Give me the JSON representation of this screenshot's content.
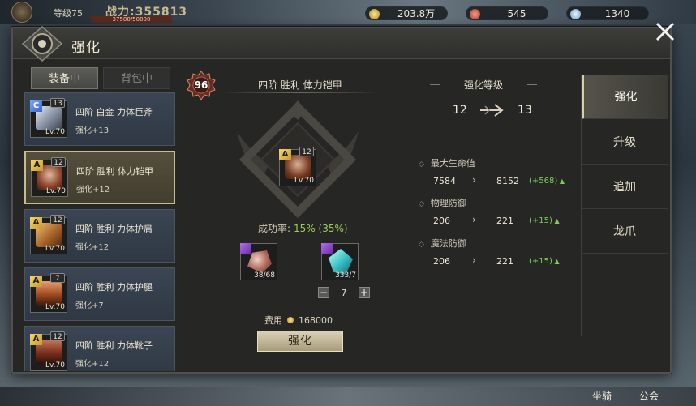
{
  "hud": {
    "level": "等级75",
    "power": "战力:355813",
    "exp": "37500/50000",
    "gold": "203.8万",
    "resource2": "545",
    "resource3": "1340"
  },
  "panel": {
    "title": "强化",
    "tabs": {
      "equipped": "装备中",
      "backpack": "背包中"
    }
  },
  "equipment": [
    {
      "grade": "C",
      "ilvl": "13",
      "lv": "Lv.70",
      "name": "四阶 白金 力体巨斧",
      "enh": "强化+13",
      "color": "#cfd6e0"
    },
    {
      "grade": "A",
      "ilvl": "12",
      "lv": "Lv.70",
      "name": "四阶 胜利 体力铠甲",
      "enh": "强化+12",
      "color": "#b8704a"
    },
    {
      "grade": "A",
      "ilvl": "12",
      "lv": "Lv.70",
      "name": "四阶 胜利 力体护肩",
      "enh": "强化+12",
      "color": "#c8843a"
    },
    {
      "grade": "A",
      "ilvl": "7",
      "lv": "Lv.70",
      "name": "四阶 胜利 力体护腿",
      "enh": "强化+7",
      "color": "#c0703a"
    },
    {
      "grade": "A",
      "ilvl": "12",
      "lv": "Lv.70",
      "name": "四阶 胜利 力体靴子",
      "enh": "强化+12",
      "color": "#a85a3a"
    }
  ],
  "selected": {
    "power_badge": "96",
    "title": "四阶 胜利 体力铠甲",
    "grade": "A",
    "ilvl": "12",
    "lv": "Lv.70",
    "rate_label": "成功率:",
    "rate_value": "15% (35%)",
    "materials": [
      {
        "count": "38/68",
        "icon": "ore-icon"
      },
      {
        "count": "333/7",
        "icon": "crystal-icon"
      }
    ],
    "quantity": "7",
    "cost_label": "费用",
    "cost_value": "168000",
    "enhance_button": "强化"
  },
  "enhance_level": {
    "label": "强化等级",
    "from": "12",
    "to": "13"
  },
  "stats": [
    {
      "name": "最大生命值",
      "old": "7584",
      "new": "8152",
      "diff": "(+568)"
    },
    {
      "name": "物理防御",
      "old": "206",
      "new": "221",
      "diff": "(+15)"
    },
    {
      "name": "魔法防御",
      "old": "206",
      "new": "221",
      "diff": "(+15)"
    }
  ],
  "side_tabs": [
    "强化",
    "升级",
    "追加",
    "龙爪"
  ],
  "world_buttons": {
    "mount": "坐骑",
    "guild": "公会"
  }
}
